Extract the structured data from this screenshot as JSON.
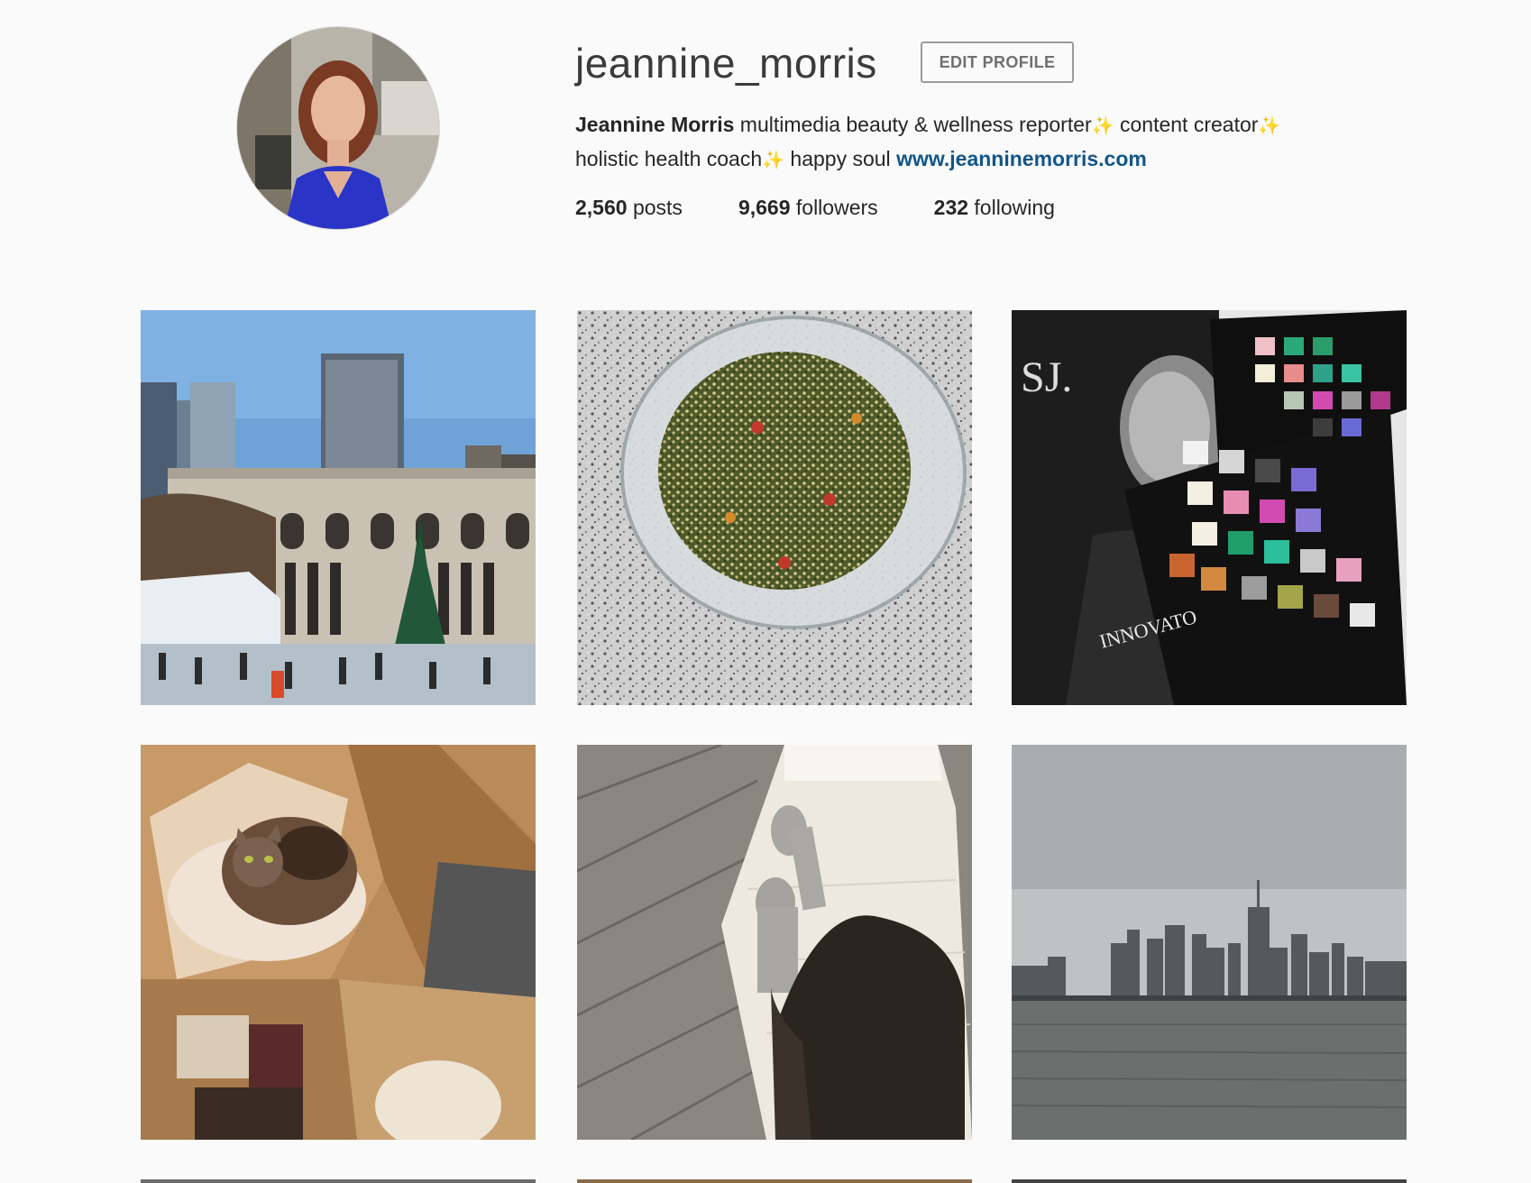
{
  "profile": {
    "username": "jeannine_morris",
    "edit_button": "EDIT PROFILE",
    "full_name": "Jeannine Morris",
    "bio_part1": " multimedia beauty & wellness reporter",
    "bio_part2": "  content creator",
    "bio_part3": "  holistic health coach",
    "bio_part4": "  happy soul ",
    "sparkle": "✨",
    "website": "www.jeanninemorris.com",
    "link_color": "#125688"
  },
  "stats": {
    "posts_count": "2,560",
    "posts_label": " posts",
    "followers_count": "9,669",
    "followers_label": " followers",
    "following_count": "232",
    "following_label": " following"
  },
  "posts": [
    {
      "subject": "city library plaza with christmas tree"
    },
    {
      "subject": "quinoa salad bowl on granite"
    },
    {
      "subject": "magazine with eyeshadow palette"
    },
    {
      "subject": "cat in cardboard box"
    },
    {
      "subject": "legs in socks on white bench"
    },
    {
      "subject": "city skyline across water"
    }
  ]
}
